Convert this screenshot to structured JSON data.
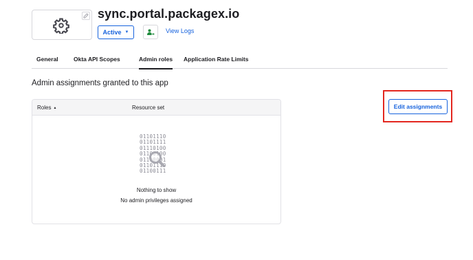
{
  "app": {
    "title": "sync.portal.packagex.io",
    "status_label": "Active",
    "view_logs_label": "View Logs",
    "logo_icon": "gear-icon"
  },
  "tabs": [
    {
      "label": "General",
      "active": false
    },
    {
      "label": "Okta API Scopes",
      "active": false
    },
    {
      "label": "Admin roles",
      "active": true
    },
    {
      "label": "Application Rate Limits",
      "active": false
    }
  ],
  "section": {
    "title": "Admin assignments granted to this app",
    "edit_button_label": "Edit assignments"
  },
  "table": {
    "columns": [
      "Roles",
      "Resource set"
    ],
    "sort_indicator": "▲",
    "empty_state": {
      "binary_lines": [
        "01101110",
        "01101111",
        "01110100",
        "01100100",
        "01100001",
        "01101110",
        "01100111"
      ],
      "title": "Nothing to show",
      "subtitle": "No admin privileges assigned"
    }
  },
  "colors": {
    "primary": "#1662dd",
    "highlight_outline": "#e3261e",
    "push_icon": "#1e8a3c",
    "border": "#d7d7dc"
  }
}
